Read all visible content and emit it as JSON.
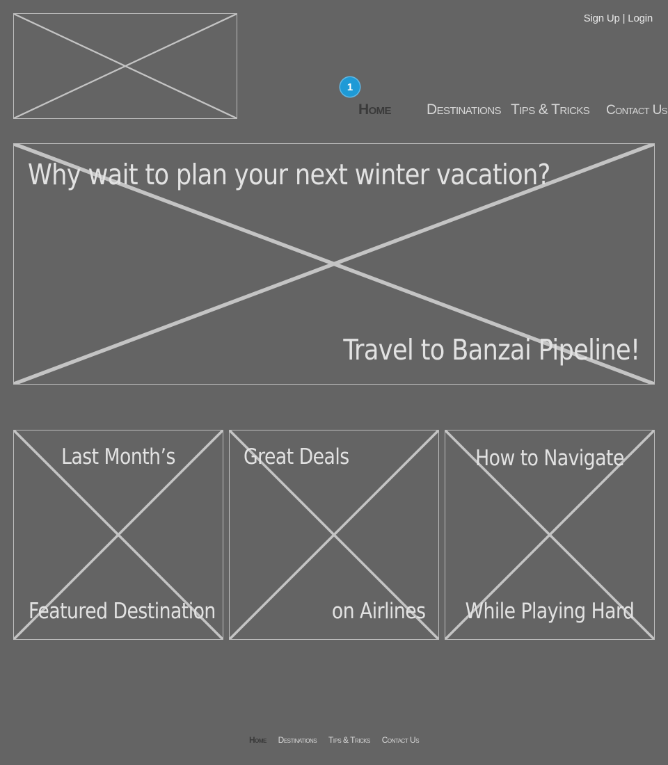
{
  "header": {
    "auth": {
      "signup": "Sign Up",
      "separator": " | ",
      "login": "Login"
    },
    "logo_alt": "",
    "nav": [
      {
        "label": "Home",
        "active": true
      },
      {
        "label": "Destinations",
        "active": false
      },
      {
        "label": "Tips & Tricks",
        "active": false
      },
      {
        "label": "Contact Us",
        "active": false
      }
    ],
    "badge": "1",
    "badge_color": "#1e9ad6"
  },
  "hero": {
    "headline": "Why wait to plan your next winter vacation?",
    "tagline": "Travel to Banzai Pipeline!"
  },
  "cards": [
    {
      "top": "Last Month’s",
      "bottom": "Featured Destination"
    },
    {
      "top": "Great Deals",
      "bottom": "on Airlines"
    },
    {
      "top": "How to Navigate",
      "bottom": "While Playing Hard"
    }
  ],
  "footer": {
    "nav": [
      {
        "label": "Home"
      },
      {
        "label": "Destinations"
      },
      {
        "label": "Tips & Tricks"
      },
      {
        "label": "Contact Us"
      }
    ]
  },
  "colors": {
    "background": "#646464",
    "placeholder_stroke": "#bdbdbd",
    "active_nav": "#3a3a3a"
  }
}
